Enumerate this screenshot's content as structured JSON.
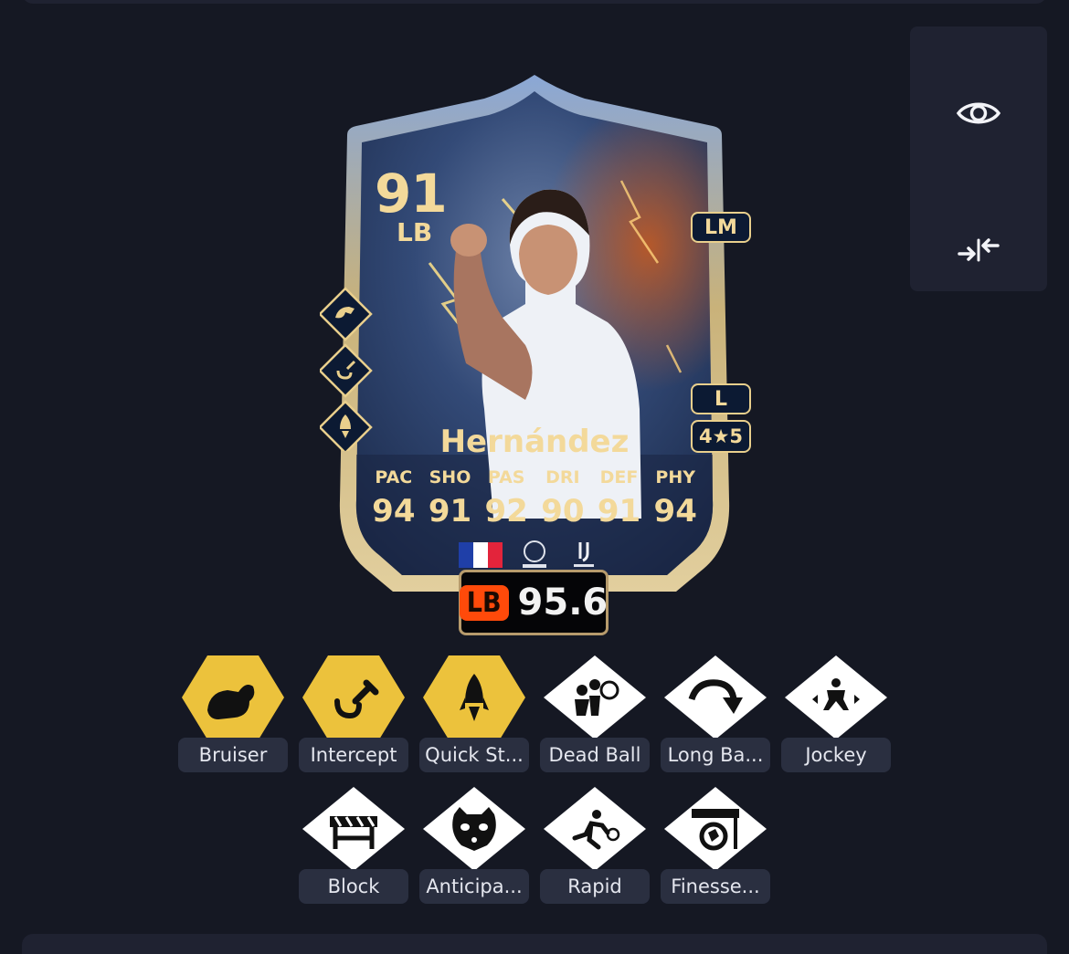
{
  "card": {
    "rating": "91",
    "position": "LB",
    "alt_position": "LM",
    "preferred_foot": "L",
    "skill_weak": "4★5",
    "name": "Hernández",
    "stats": [
      {
        "label": "PAC",
        "value": "94"
      },
      {
        "label": "SHO",
        "value": "91"
      },
      {
        "label": "PAS",
        "value": "92"
      },
      {
        "label": "DRI",
        "value": "90"
      },
      {
        "label": "DEF",
        "value": "91"
      },
      {
        "label": "PHY",
        "value": "94"
      }
    ],
    "nation": "France",
    "league": "Roshn Saudi League",
    "club": "Al Hilal"
  },
  "rating_badge": {
    "position": "LB",
    "score": "95.6"
  },
  "side_actions": [
    {
      "name": "view",
      "icon": "eye-icon"
    },
    {
      "name": "compare",
      "icon": "compare-arrows-icon"
    }
  ],
  "playstyles": [
    {
      "label": "Bruiser",
      "plus": true,
      "icon": "flexed-arm-icon"
    },
    {
      "label": "Intercept",
      "plus": true,
      "icon": "hook-icon"
    },
    {
      "label": "Quick St...",
      "plus": true,
      "icon": "rocket-icon"
    },
    {
      "label": "Dead Ball",
      "plus": false,
      "icon": "dead-ball-icon"
    },
    {
      "label": "Long Ba...",
      "plus": false,
      "icon": "curved-arrow-icon"
    },
    {
      "label": "Jockey",
      "plus": false,
      "icon": "jockey-icon"
    },
    {
      "label": "Block",
      "plus": false,
      "icon": "barrier-icon"
    },
    {
      "label": "Anticipa...",
      "plus": false,
      "icon": "raccoon-icon"
    },
    {
      "label": "Rapid",
      "plus": false,
      "icon": "runner-icon"
    },
    {
      "label": "Finesse...",
      "plus": false,
      "icon": "finesse-shot-icon"
    }
  ],
  "colors": {
    "background": "#151823",
    "panel": "#1f2231",
    "gold": "#f3d99a",
    "plus_fill": "#ecc23c",
    "badge_accent": "#ff4a0a"
  }
}
